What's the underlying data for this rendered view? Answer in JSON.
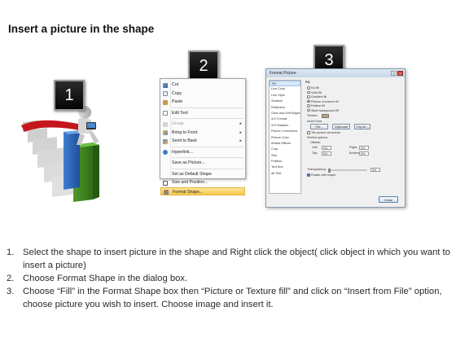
{
  "title": "Insert a picture in the shape",
  "badges": [
    "1",
    "2",
    "3"
  ],
  "context_menu": {
    "items": [
      {
        "label": "Cut",
        "icon": "scissors-icon",
        "accel": "t"
      },
      {
        "label": "Copy",
        "icon": "copy-icon"
      },
      {
        "label": "Paste",
        "icon": "paste-icon"
      },
      {
        "label": "Edit Text",
        "icon": "edit-text-icon"
      },
      {
        "label": "Group",
        "icon": "group-icon",
        "disabled": true,
        "submenu": true
      },
      {
        "label": "Bring to Front",
        "icon": "bring-front-icon",
        "submenu": true
      },
      {
        "label": "Send to Back",
        "icon": "send-back-icon",
        "submenu": true
      },
      {
        "label": "Hyperlink...",
        "icon": "hyperlink-icon"
      },
      {
        "label": "Save as Picture...",
        "icon": ""
      },
      {
        "label": "Set as Default Shape",
        "icon": ""
      },
      {
        "label": "Size and Position...",
        "icon": "size-position-icon"
      },
      {
        "label": "Format Shape...",
        "icon": "format-shape-icon",
        "highlighted": true
      }
    ]
  },
  "dialog": {
    "title": "Format Picture",
    "title_buttons": [
      "?",
      "×"
    ],
    "nav": [
      "Fill",
      "Line Color",
      "Line Style",
      "Shadow",
      "Reflection",
      "Glow and Soft Edges",
      "3-D Format",
      "3-D Rotation",
      "Picture Corrections",
      "Picture Color",
      "Artistic Effects",
      "Crop",
      "Size",
      "Position",
      "Text Box",
      "Alt Text"
    ],
    "selected_nav": "Fill",
    "fill_heading": "Fill",
    "fill_options": [
      {
        "label": "No fill",
        "on": false
      },
      {
        "label": "Solid fill",
        "on": false
      },
      {
        "label": "Gradient fill",
        "on": false
      },
      {
        "label": "Picture or texture fill",
        "on": true
      },
      {
        "label": "Pattern fill",
        "on": false
      },
      {
        "label": "Slide background fill",
        "on": false
      }
    ],
    "texture_label": "Texture:",
    "insert_from_label": "Insert from:",
    "buttons": {
      "file": "File...",
      "clipboard": "Clipboard",
      "clip_art": "Clip Art..."
    },
    "tile_label": "Tile picture as texture",
    "stretch_label": "Stretch options",
    "offsets_label": "Offsets:",
    "offsets": [
      {
        "label": "Left:",
        "value": "0%"
      },
      {
        "label": "Right:",
        "value": "0%"
      },
      {
        "label": "Top:",
        "value": "0%"
      },
      {
        "label": "Bottom:",
        "value": "0%"
      }
    ],
    "transparency_label": "Transparency:",
    "transparency_value": "0%",
    "rotate_label": "Rotate with shape",
    "close_label": "Close"
  },
  "instructions": [
    {
      "num": "1.",
      "text": "Select the shape to insert picture in the shape and Right click the object( click object in which you want to insert a picture)"
    },
    {
      "num": "2.",
      "text": "Choose Format Shape in the dialog box."
    },
    {
      "num": "3.",
      "text": "Choose “Fill” in the Format Shape box then “Picture or Texture fill”  and click on “Insert from File” option, choose picture you wish to insert. Choose image and insert it."
    }
  ]
}
